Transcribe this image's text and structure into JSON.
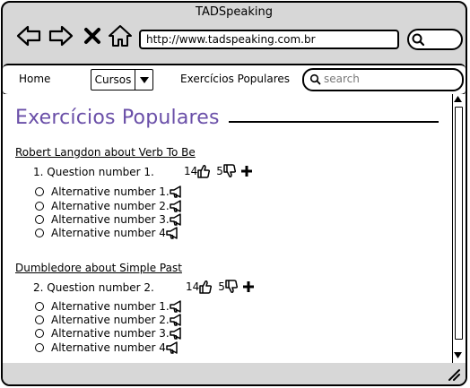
{
  "window": {
    "title": "TADSpeaking"
  },
  "toolbar": {
    "back_icon": "back-arrow-icon",
    "forward_icon": "forward-arrow-icon",
    "stop_icon": "close-icon",
    "home_icon": "home-icon",
    "url": "http://www.tadspeaking.com.br"
  },
  "menu": {
    "home": "Home",
    "cursos": "Cursos",
    "popular": "Exercícios Populares",
    "search_placeholder": "search"
  },
  "page": {
    "title": "Exercícios Populares"
  },
  "exercises": [
    {
      "title": "Robert Langdon about Verb To Be",
      "question": "1. Question number 1.",
      "likes": "14",
      "dislikes": "5",
      "alternatives": [
        "Alternative number 1.",
        "Alternative number 2.",
        "Alternative number 3.",
        "Alternative number 4"
      ]
    },
    {
      "title": "Dumbledore about Simple Past",
      "question": "2. Question number 2.",
      "likes": "14",
      "dislikes": "5",
      "alternatives": [
        "Alternative number 1.",
        "Alternative number 2.",
        "Alternative number 3.",
        "Alternative number 4"
      ]
    }
  ]
}
